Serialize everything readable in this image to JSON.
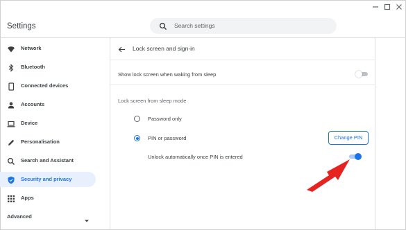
{
  "window": {
    "title": "Settings",
    "controls": [
      "minimize-icon",
      "maximize-icon",
      "close-icon"
    ]
  },
  "search": {
    "placeholder": "Search settings",
    "icon": "search-icon"
  },
  "sidebar": {
    "items": [
      {
        "label": "Network",
        "icon": "wifi-icon",
        "active": false
      },
      {
        "label": "Bluetooth",
        "icon": "bluetooth-icon",
        "active": false
      },
      {
        "label": "Connected devices",
        "icon": "phone-icon",
        "active": false
      },
      {
        "label": "Accounts",
        "icon": "person-icon",
        "active": false
      },
      {
        "label": "Device",
        "icon": "laptop-icon",
        "active": false
      },
      {
        "label": "Personalisation",
        "icon": "pencil-icon",
        "active": false
      },
      {
        "label": "Search and Assistant",
        "icon": "search-icon",
        "active": false
      },
      {
        "label": "Security and privacy",
        "icon": "shield-icon",
        "active": true
      },
      {
        "label": "Apps",
        "icon": "apps-grid-icon",
        "active": false
      }
    ],
    "advanced_label": "Advanced"
  },
  "page": {
    "title": "Lock screen and sign-in",
    "show_lock_screen": {
      "label": "Show lock screen when waking from sleep",
      "enabled": false
    },
    "sleep_mode_section": "Lock screen from sleep mode",
    "options": [
      {
        "label": "Password only",
        "selected": false
      },
      {
        "label": "PIN or password",
        "selected": true
      }
    ],
    "change_pin_label": "Change PIN",
    "unlock_auto": {
      "label": "Unlock automatically once PIN is entered",
      "enabled": true
    }
  },
  "colors": {
    "accent": "#1a73e8",
    "active_bg": "#e8f0fe",
    "annotation_arrow": "#e52421"
  }
}
